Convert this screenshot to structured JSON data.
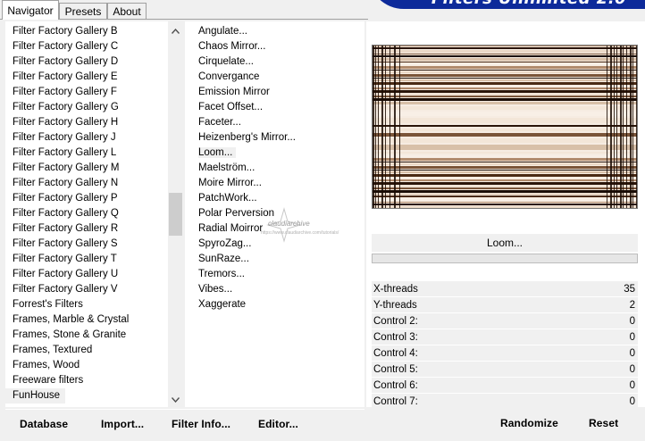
{
  "tabs": [
    {
      "label": "Navigator",
      "active": true
    },
    {
      "label": "Presets",
      "active": false
    },
    {
      "label": "About",
      "active": false
    }
  ],
  "banner": {
    "title": "Filters Unlimited 2.0",
    "color": "#0d2a9a"
  },
  "categories": [
    "Filter Factory Gallery B",
    "Filter Factory Gallery C",
    "Filter Factory Gallery D",
    "Filter Factory Gallery E",
    "Filter Factory Gallery F",
    "Filter Factory Gallery G",
    "Filter Factory Gallery H",
    "Filter Factory Gallery J",
    "Filter Factory Gallery L",
    "Filter Factory Gallery M",
    "Filter Factory Gallery N",
    "Filter Factory Gallery P",
    "Filter Factory Gallery Q",
    "Filter Factory Gallery R",
    "Filter Factory Gallery S",
    "Filter Factory Gallery T",
    "Filter Factory Gallery U",
    "Filter Factory Gallery V",
    "Forrest's Filters",
    "Frames, Marble & Crystal",
    "Frames, Stone & Granite",
    "Frames, Textured",
    "Frames, Wood",
    "Freeware filters",
    "FunHouse"
  ],
  "selected_category": "FunHouse",
  "filters": [
    "Angulate...",
    "Chaos Mirror...",
    "Cirquelate...",
    "Convergance",
    "Emission Mirror",
    "Facet Offset...",
    "Faceter...",
    "Heizenberg's Mirror...",
    "Loom...",
    "Maelström...",
    "Moire Mirror...",
    "PatchWork...",
    "Polar Perversion",
    "Radial Moirror",
    "SpyroZag...",
    "SunRaze...",
    "Tremors...",
    "Vibes...",
    "Xaggerate"
  ],
  "selected_filter": "Loom...",
  "preview": {
    "filter_name": "Loom..."
  },
  "controls": [
    {
      "label": "X-threads",
      "value": "35"
    },
    {
      "label": "Y-threads",
      "value": "2"
    },
    {
      "label": "Control 2:",
      "value": "0"
    },
    {
      "label": "Control 3:",
      "value": "0"
    },
    {
      "label": "Control 4:",
      "value": "0"
    },
    {
      "label": "Control 5:",
      "value": "0"
    },
    {
      "label": "Control 6:",
      "value": "0"
    },
    {
      "label": "Control 7:",
      "value": "0"
    }
  ],
  "bottom_buttons": {
    "database": "Database",
    "import": "Import...",
    "filter_info": "Filter Info...",
    "editor": "Editor...",
    "randomize": "Randomize",
    "reset": "Reset"
  },
  "watermark": {
    "line1": "claudiarchive",
    "line2": "https://www.claudiarchive.com/tutorials/"
  },
  "icons": {
    "scroll_up": "chevron-up-icon",
    "scroll_down": "chevron-down-icon"
  }
}
